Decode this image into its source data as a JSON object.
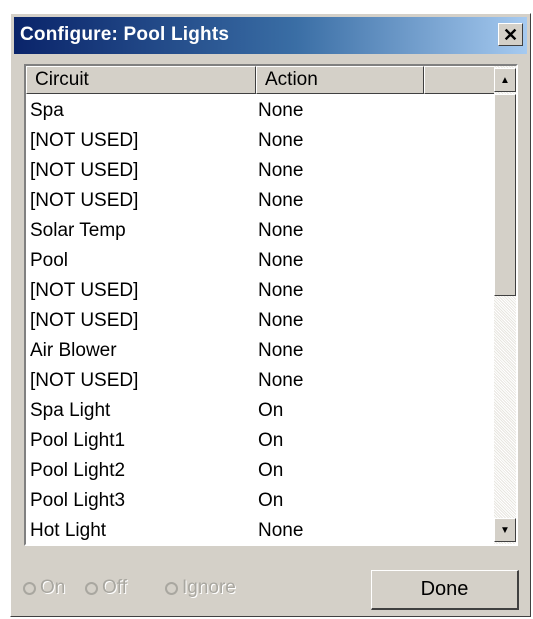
{
  "window": {
    "title": "Configure: Pool Lights",
    "close_label": "✕",
    "titlebar_colors": [
      "#0a246a",
      "#a6caf0"
    ]
  },
  "list": {
    "columns": [
      "Circuit",
      "Action"
    ],
    "rows": [
      {
        "circuit": "Spa",
        "action": "None"
      },
      {
        "circuit": "[NOT USED]",
        "action": "None"
      },
      {
        "circuit": "[NOT USED]",
        "action": "None"
      },
      {
        "circuit": "[NOT USED]",
        "action": "None"
      },
      {
        "circuit": "Solar Temp",
        "action": "None"
      },
      {
        "circuit": "Pool",
        "action": "None"
      },
      {
        "circuit": "[NOT USED]",
        "action": "None"
      },
      {
        "circuit": "[NOT USED]",
        "action": "None"
      },
      {
        "circuit": "Air Blower",
        "action": "None"
      },
      {
        "circuit": "[NOT USED]",
        "action": "None"
      },
      {
        "circuit": "Spa Light",
        "action": "On"
      },
      {
        "circuit": "Pool Light1",
        "action": "On"
      },
      {
        "circuit": "Pool Light2",
        "action": "On"
      },
      {
        "circuit": "Pool Light3",
        "action": "On"
      },
      {
        "circuit": "Hot Light",
        "action": "None"
      }
    ],
    "scroll_up_icon": "▲",
    "scroll_down_icon": "▼"
  },
  "options": {
    "on_label": "On",
    "off_label": "Off",
    "ignore_label": "Ignore"
  },
  "done_label": "Done"
}
